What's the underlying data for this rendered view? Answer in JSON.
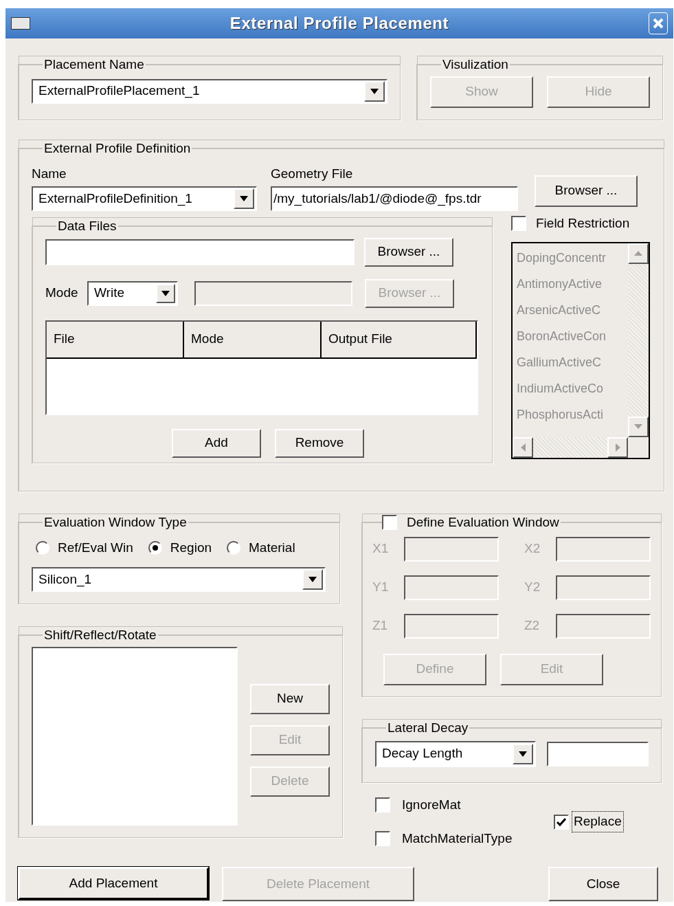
{
  "window": {
    "title": "External Profile Placement"
  },
  "placement_name": {
    "label": "Placement Name",
    "value": "ExternalProfilePlacement_1"
  },
  "visualization": {
    "label": "Visulization",
    "buttons": [
      {
        "label": "Show",
        "disabled": true
      },
      {
        "label": "Hide",
        "disabled": true
      }
    ]
  },
  "profile_definition": {
    "label": "External Profile Definition",
    "name_label": "Name",
    "name_value": "ExternalProfileDefinition_1",
    "geometry_label": "Geometry File",
    "geometry_value": "/my_tutorials/lab1/@diode@_fps.tdr",
    "browser_button": {
      "label": "Browser ...",
      "disabled": false
    },
    "data_files": {
      "label": "Data Files",
      "browser_button": {
        "label": "Browser ...",
        "disabled": false
      },
      "mode_label": "Mode",
      "mode_value": "Write",
      "output_browser_button": {
        "label": "Browser ...",
        "disabled": true
      },
      "table": {
        "columns": [
          "File",
          "Mode",
          "Output File"
        ]
      },
      "buttons": [
        {
          "label": "Add",
          "disabled": false
        },
        {
          "label": "Remove",
          "disabled": false
        }
      ]
    },
    "field_restriction": {
      "label": "Field Restriction",
      "checked": false,
      "items": [
        {
          "label": "DopingConcentr",
          "disabled": true
        },
        {
          "label": "AntimonyActive",
          "disabled": true
        },
        {
          "label": "ArsenicActiveC",
          "disabled": true
        },
        {
          "label": "BoronActiveCon",
          "disabled": true
        },
        {
          "label": "GalliumActiveC",
          "disabled": true
        },
        {
          "label": "IndiumActiveCo",
          "disabled": true
        },
        {
          "label": "PhosphorusActi",
          "disabled": true
        }
      ]
    }
  },
  "evaluation_window_type": {
    "label": "Evaluation Window Type",
    "options": [
      {
        "label": "Ref/Eval Win",
        "selected": false
      },
      {
        "label": "Region",
        "selected": true
      },
      {
        "label": "Material",
        "selected": false
      }
    ],
    "value": "Silicon_1"
  },
  "shift_reflect_rotate": {
    "label": "Shift/Reflect/Rotate",
    "buttons": [
      {
        "label": "New",
        "disabled": false
      },
      {
        "label": "Edit",
        "disabled": true
      },
      {
        "label": "Delete",
        "disabled": true
      }
    ]
  },
  "define_evaluation_window": {
    "label": "Define Evaluation Window",
    "checked": false,
    "fields": [
      {
        "label": "X1",
        "disabled": true
      },
      {
        "label": "X2",
        "disabled": true
      },
      {
        "label": "Y1",
        "disabled": true
      },
      {
        "label": "Y2",
        "disabled": true
      },
      {
        "label": "Z1",
        "disabled": true
      },
      {
        "label": "Z2",
        "disabled": true
      }
    ],
    "buttons": [
      {
        "label": "Define",
        "disabled": true
      },
      {
        "label": "Edit",
        "disabled": true
      }
    ]
  },
  "lateral_decay": {
    "label": "Lateral Decay",
    "value": "Decay Length"
  },
  "options": [
    {
      "label": "IgnoreMat",
      "checked": false,
      "focused": false
    },
    {
      "label": "MatchMaterialType",
      "checked": false,
      "focused": false
    },
    {
      "label": "Replace",
      "checked": true,
      "focused": true
    }
  ],
  "footer_buttons": [
    {
      "label": "Add Placement",
      "disabled": false,
      "default": true
    },
    {
      "label": "Delete Placement",
      "disabled": true,
      "default": false
    },
    {
      "label": "Close",
      "disabled": false,
      "default": false
    }
  ]
}
